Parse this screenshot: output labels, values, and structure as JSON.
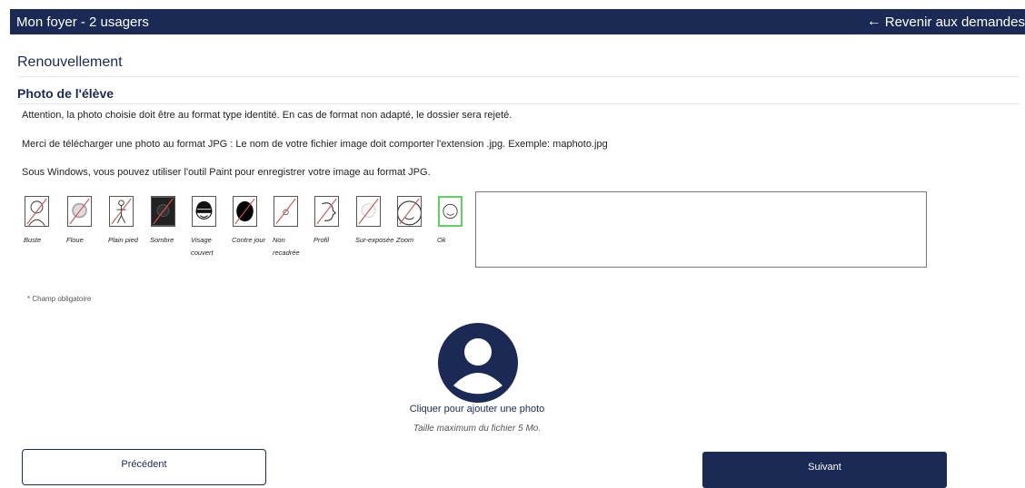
{
  "header": {
    "title": "Mon foyer - 2 usagers",
    "back_label": "Revenir aux demandes"
  },
  "section": {
    "title": "Renouvellement"
  },
  "photo": {
    "title": "Photo de l'élève",
    "line1": "Attention, la photo choisie doit être au format type identité. En cas de format non adapté, le dossier sera rejeté.",
    "line2": "Merci de télécharger une photo au format JPG : Le nom de votre fichier image doit comporter l'extension .jpg. Exemple: maphoto.jpg",
    "line3": "Sous Windows, vous pouvez utiliser l'outil Paint pour enregistrer votre image au format JPG.",
    "samples": [
      {
        "label": "Buste"
      },
      {
        "label": "Floue"
      },
      {
        "label": "Plain pied"
      },
      {
        "label": "Sombre"
      },
      {
        "label": "Visage couvert"
      },
      {
        "label": "Contre jour"
      },
      {
        "label": "Non recadrée"
      },
      {
        "label": "Profil"
      },
      {
        "label": "Sur-exposée"
      },
      {
        "label": "Zoom"
      },
      {
        "label": "Ok"
      }
    ],
    "mandatory_note": "* Champ obligatoire",
    "add_label": "Cliquer pour ajouter une photo",
    "max_size": "Taille maximum du fichier 5 Mo."
  },
  "nav": {
    "prev_label": "Précédent",
    "next_label": "Suivant"
  },
  "colors": {
    "primary": "#1b2a55",
    "ok": "#5fd35f",
    "reject": "#d9534f"
  }
}
